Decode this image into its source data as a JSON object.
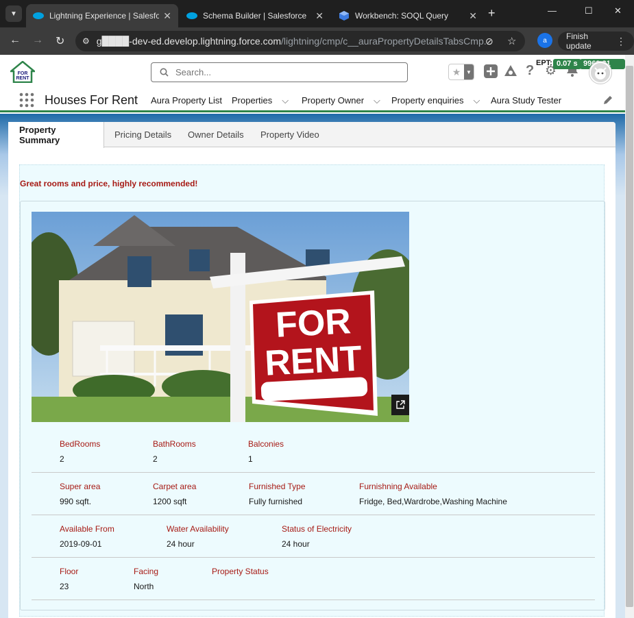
{
  "browser": {
    "tabs": [
      {
        "title": "Lightning Experience | Salesforce",
        "active": true
      },
      {
        "title": "Schema Builder | Salesforce",
        "active": false
      },
      {
        "title": "Workbench: SOQL Query",
        "active": false
      }
    ],
    "url_host": "g████-dev-ed.develop.lightning.force.com",
    "url_path": "/lightning/cmp/c__auraPropertyDetailsTabsCmp...",
    "profile_initial": "a",
    "finish_update_label": "Finish update"
  },
  "header": {
    "logo_text_top": "FOR",
    "logo_text_bottom": "RENT",
    "search_placeholder": "Search...",
    "ept_label": "EPT:",
    "ept_value": "0.07 s",
    "memory_value": "9963.31 KB"
  },
  "nav": {
    "app_name": "Houses For Rent",
    "items": [
      {
        "label": "Aura Property List",
        "has_menu": false
      },
      {
        "label": "Properties",
        "has_menu": true
      },
      {
        "label": "Property Owner",
        "has_menu": true
      },
      {
        "label": "Property enquiries",
        "has_menu": true
      },
      {
        "label": "Aura Study Tester",
        "has_menu": false
      }
    ]
  },
  "tabs": [
    {
      "label": "Property Summary",
      "active": true
    },
    {
      "label": "Pricing Details",
      "active": false
    },
    {
      "label": "Owner Details",
      "active": false
    },
    {
      "label": "Property Video",
      "active": false
    }
  ],
  "summary": {
    "recommendation": "Great rooms and price, highly recommended!",
    "sign_line1": "FOR",
    "sign_line2": "RENT",
    "rows": [
      [
        {
          "label": "BedRooms",
          "value": "2"
        },
        {
          "label": "BathRooms",
          "value": "2"
        },
        {
          "label": "Balconies",
          "value": "1"
        }
      ],
      [
        {
          "label": "Super area",
          "value": "990 sqft."
        },
        {
          "label": "Carpet area",
          "value": "1200 sqft"
        },
        {
          "label": "Furnished Type",
          "value": "Fully furnished"
        },
        {
          "label": "Furnishning Available",
          "value": "Fridge, Bed,Wardrobe,Washing Machine"
        }
      ],
      [
        {
          "label": "Available From",
          "value": "2019-09-01"
        },
        {
          "label": "Water Availability",
          "value": "24 hour"
        },
        {
          "label": "Status of Electricity",
          "value": "24 hour"
        }
      ],
      [
        {
          "label": "Floor",
          "value": "23"
        },
        {
          "label": "Facing",
          "value": "North"
        },
        {
          "label": "Property Status",
          "value": ""
        }
      ]
    ]
  },
  "colors": {
    "accent_green": "#2e844a",
    "label_red": "#a61a14",
    "panel_bg": "#edfbfe"
  }
}
